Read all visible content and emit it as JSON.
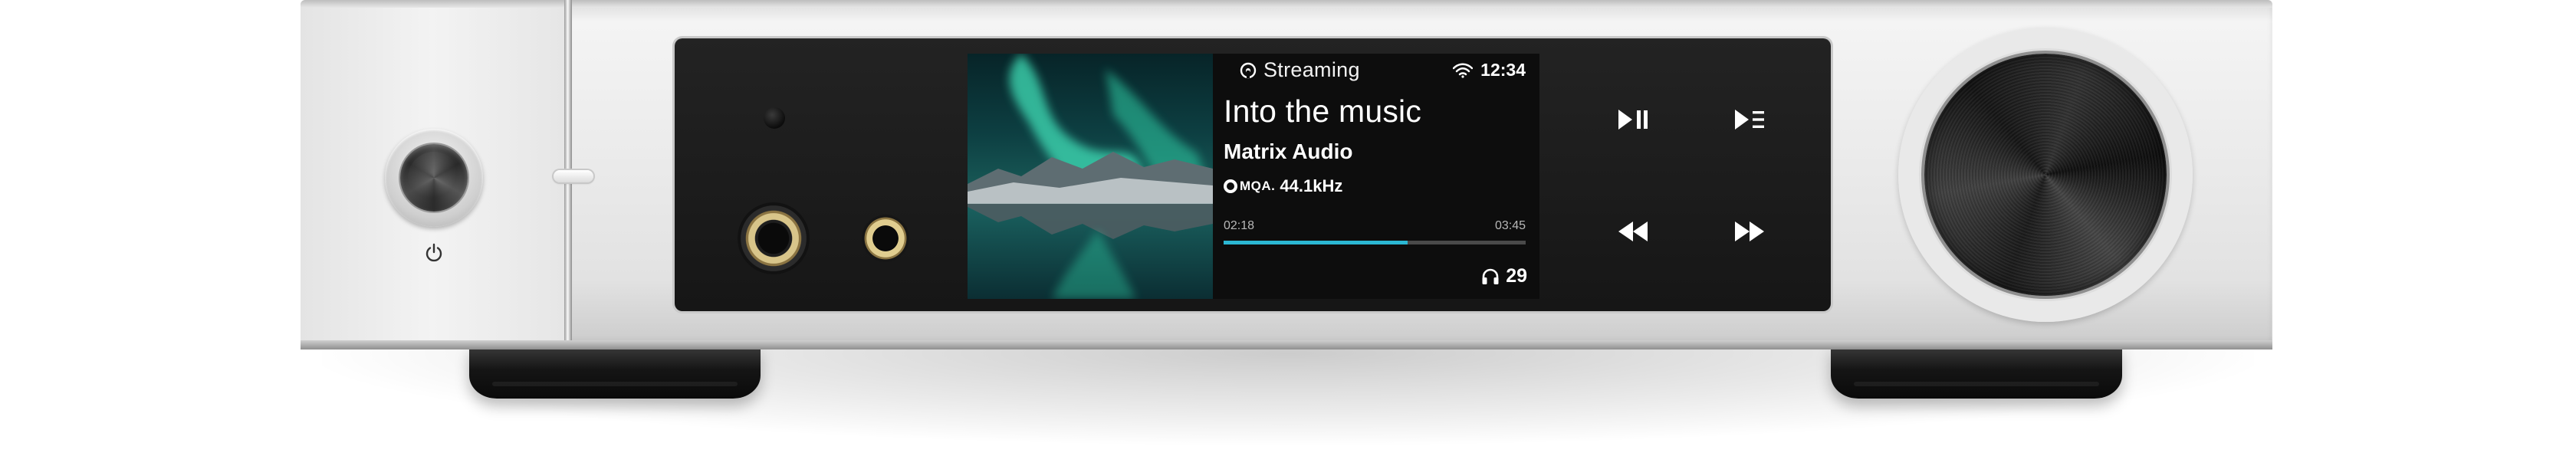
{
  "device": {
    "colors": {
      "chassis": "#e6e6e6",
      "front_panel": "#1a1a1a",
      "accent_progress": "#2bb7d3",
      "jack_gold": "#d8c58a"
    }
  },
  "screen": {
    "source_label": "Streaming",
    "source_icon": "streaming-icon",
    "wifi_icon": "wifi-icon",
    "clock": "12:34",
    "track_title": "Into the music",
    "artist": "Matrix Audio",
    "format_badge": "MQA.",
    "sample_rate": "44.1kHz",
    "time_elapsed": "02:18",
    "time_total": "03:45",
    "progress_fraction": 0.61,
    "volume_icon": "headphones-icon",
    "volume": "29",
    "album_art": "aurora-over-mountain-lake"
  },
  "controls": [
    {
      "name": "play-pause",
      "icon": "play-pause-icon"
    },
    {
      "name": "queue-play",
      "icon": "play-queue-icon"
    },
    {
      "name": "previous",
      "icon": "rewind-icon"
    },
    {
      "name": "next",
      "icon": "fast-forward-icon"
    }
  ],
  "left_panel": {
    "power_icon": "power-icon"
  }
}
